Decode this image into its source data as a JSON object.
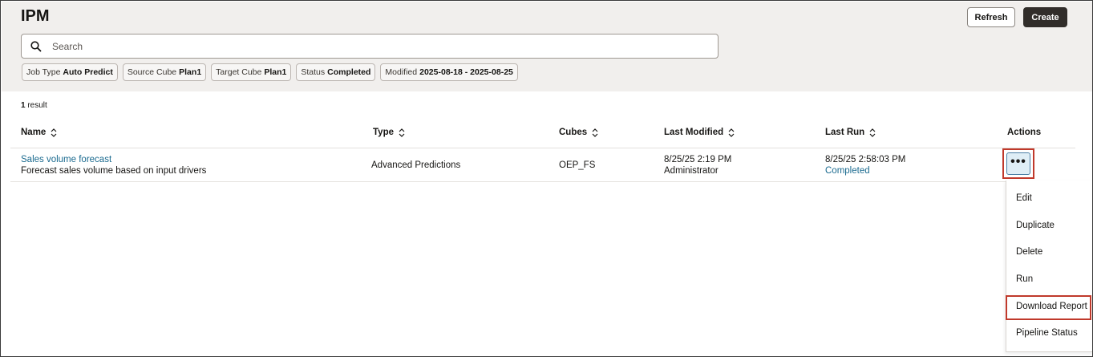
{
  "header": {
    "title": "IPM",
    "refresh_label": "Refresh",
    "create_label": "Create"
  },
  "search": {
    "placeholder": "Search",
    "value": "",
    "icon": "search-icon"
  },
  "filters": [
    {
      "key": "Job Type",
      "value": "Auto Predict"
    },
    {
      "key": "Source Cube",
      "value": "Plan1"
    },
    {
      "key": "Target Cube",
      "value": "Plan1"
    },
    {
      "key": "Status",
      "value": "Completed"
    },
    {
      "key": "Modified",
      "value": "2025-08-18 - 2025-08-25"
    }
  ],
  "results": {
    "count": "1",
    "label": "result"
  },
  "table": {
    "columns": {
      "name": "Name",
      "type": "Type",
      "cubes": "Cubes",
      "last_modified": "Last Modified",
      "last_run": "Last Run",
      "actions": "Actions"
    },
    "rows": [
      {
        "name": "Sales volume forecast",
        "description": "Forecast sales volume based on input drivers",
        "type": "Advanced Predictions",
        "cubes": "OEP_FS",
        "last_modified_date": "8/25/25 2:19 PM",
        "last_modified_by": "Administrator",
        "last_run_date": "8/25/25 2:58:03 PM",
        "last_run_status": "Completed",
        "actions_label": "•••"
      }
    ]
  },
  "menu": {
    "items": [
      {
        "label": "Edit"
      },
      {
        "label": "Duplicate"
      },
      {
        "label": "Delete"
      },
      {
        "label": "Run"
      },
      {
        "label": "Download Report"
      },
      {
        "label": "Pipeline Status"
      }
    ],
    "highlighted": "Download Report"
  },
  "colors": {
    "header_bg": "#f1efed",
    "link": "#1a6a8f",
    "highlight_border": "#c0392b",
    "primary_button": "#312d2a"
  }
}
